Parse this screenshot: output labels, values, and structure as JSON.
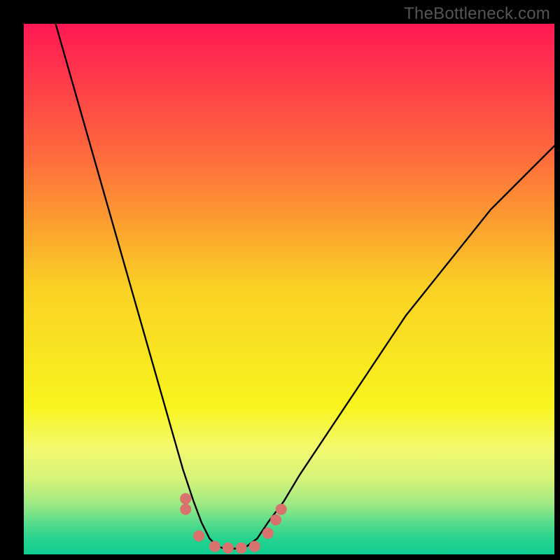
{
  "watermark": "TheBottleneck.com",
  "chart_data": {
    "type": "line",
    "title": "",
    "xlabel": "",
    "ylabel": "",
    "xlim": [
      0,
      100
    ],
    "ylim": [
      0,
      100
    ],
    "grid": false,
    "legend": false,
    "series": [
      {
        "name": "left-curve",
        "color": "#000000",
        "x": [
          6,
          8,
          10,
          12,
          14,
          16,
          18,
          20,
          22,
          24,
          26,
          28,
          30,
          32,
          33.5,
          35,
          36.5
        ],
        "y": [
          100,
          93,
          86,
          79,
          72,
          65,
          58,
          51,
          44,
          37,
          30,
          23,
          16,
          10,
          6,
          3,
          1.5
        ]
      },
      {
        "name": "right-curve",
        "color": "#000000",
        "x": [
          42,
          44,
          46,
          49,
          52,
          56,
          60,
          64,
          68,
          72,
          76,
          80,
          84,
          88,
          92,
          96,
          100
        ],
        "y": [
          1.5,
          3,
          6,
          10,
          15,
          21,
          27,
          33,
          39,
          45,
          50,
          55,
          60,
          65,
          69,
          73,
          77
        ]
      },
      {
        "name": "valley-floor",
        "color": "#000000",
        "x": [
          36.5,
          37.5,
          38.5,
          39.5,
          40.5,
          41.5,
          42
        ],
        "y": [
          1.5,
          1.2,
          1.1,
          1.1,
          1.1,
          1.2,
          1.5
        ]
      }
    ],
    "markers": [
      {
        "x": 30.5,
        "y": 10.5,
        "r": 8,
        "color": "#d9716c"
      },
      {
        "x": 30.5,
        "y": 8.5,
        "r": 8,
        "color": "#d9716c"
      },
      {
        "x": 33.0,
        "y": 3.5,
        "r": 8,
        "color": "#d9716c"
      },
      {
        "x": 36.0,
        "y": 1.5,
        "r": 8,
        "color": "#d9716c"
      },
      {
        "x": 38.5,
        "y": 1.2,
        "r": 8,
        "color": "#d9716c"
      },
      {
        "x": 41.0,
        "y": 1.2,
        "r": 8,
        "color": "#d9716c"
      },
      {
        "x": 43.5,
        "y": 1.5,
        "r": 8,
        "color": "#d9716c"
      },
      {
        "x": 46.0,
        "y": 4.0,
        "r": 8,
        "color": "#d9716c"
      },
      {
        "x": 47.5,
        "y": 6.5,
        "r": 8,
        "color": "#d9716c"
      },
      {
        "x": 48.5,
        "y": 8.5,
        "r": 8,
        "color": "#d9716c"
      }
    ],
    "background_gradient": {
      "stops": [
        {
          "offset": 0.0,
          "color": "#ff1854"
        },
        {
          "offset": 0.25,
          "color": "#fe6b3c"
        },
        {
          "offset": 0.5,
          "color": "#fad224"
        },
        {
          "offset": 0.72,
          "color": "#f8f41e"
        },
        {
          "offset": 0.8,
          "color": "#f3f96e"
        },
        {
          "offset": 0.86,
          "color": "#d4f37a"
        },
        {
          "offset": 0.905,
          "color": "#9de983"
        },
        {
          "offset": 0.94,
          "color": "#58dc8b"
        },
        {
          "offset": 0.97,
          "color": "#28d28f"
        },
        {
          "offset": 1.0,
          "color": "#0ecd91"
        }
      ]
    }
  }
}
